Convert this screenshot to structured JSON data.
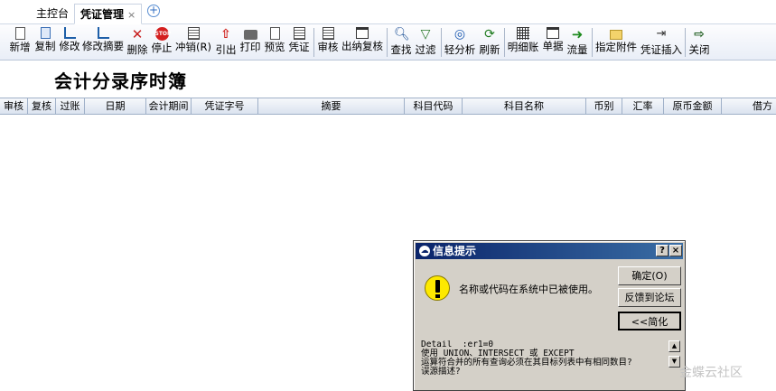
{
  "tabs": [
    {
      "label": "主控台"
    },
    {
      "label": "凭证管理",
      "close": "×"
    }
  ],
  "tab_add": "+",
  "toolbar": [
    {
      "label": "新增",
      "icon": "new-doc-icon"
    },
    {
      "label": "复制",
      "icon": "copy-icon"
    },
    {
      "label": "修改",
      "icon": "edit-chart-icon"
    },
    {
      "label": "修改摘要",
      "icon": "edit-summary-icon"
    },
    {
      "label": "删除",
      "icon": "delete-icon"
    },
    {
      "label": "停止",
      "icon": "stop-icon"
    },
    {
      "label": "冲销(R)",
      "icon": "reverse-icon"
    },
    {
      "label": "引出",
      "icon": "export-icon"
    },
    {
      "label": "打印",
      "icon": "print-icon"
    },
    {
      "label": "预览",
      "icon": "preview-icon"
    },
    {
      "label": "凭证",
      "icon": "voucher-icon"
    },
    {
      "label": "审核",
      "icon": "audit-icon"
    },
    {
      "label": "出纳复核",
      "icon": "cashier-review-icon"
    },
    {
      "label": "查找",
      "icon": "find-icon"
    },
    {
      "label": "过滤",
      "icon": "filter-icon"
    },
    {
      "label": "轻分析",
      "icon": "analysis-icon"
    },
    {
      "label": "刷新",
      "icon": "refresh-icon"
    },
    {
      "label": "明细账",
      "icon": "detail-ledger-icon"
    },
    {
      "label": "单据",
      "icon": "document-icon"
    },
    {
      "label": "流量",
      "icon": "flow-icon"
    },
    {
      "label": "指定附件",
      "icon": "attachment-icon"
    },
    {
      "label": "凭证插入",
      "icon": "insert-voucher-icon"
    },
    {
      "label": "关闭",
      "icon": "close-exit-icon"
    }
  ],
  "report_title": "会计分录序时簿",
  "columns": [
    "审核",
    "复核",
    "过账",
    "日期",
    "会计期间",
    "凭证字号",
    "摘要",
    "科目代码",
    "科目名称",
    "币别",
    "汇率",
    "原币金额",
    "借方"
  ],
  "dialog": {
    "title": "信息提示",
    "help_button": "?",
    "close_button": "×",
    "message": "名称或代码在系统中已被使用。",
    "buttons": {
      "ok": "确定(O)",
      "feedback": "反馈到论坛",
      "simplify": "<<简化"
    },
    "detail": "Detail  :er1=0\n使用 UNION、INTERSECT 或 EXCEPT\n运算符合并的所有查询必须在其目标列表中有相同数目?\n误源描述?"
  },
  "watermark": "金蝶云社区"
}
